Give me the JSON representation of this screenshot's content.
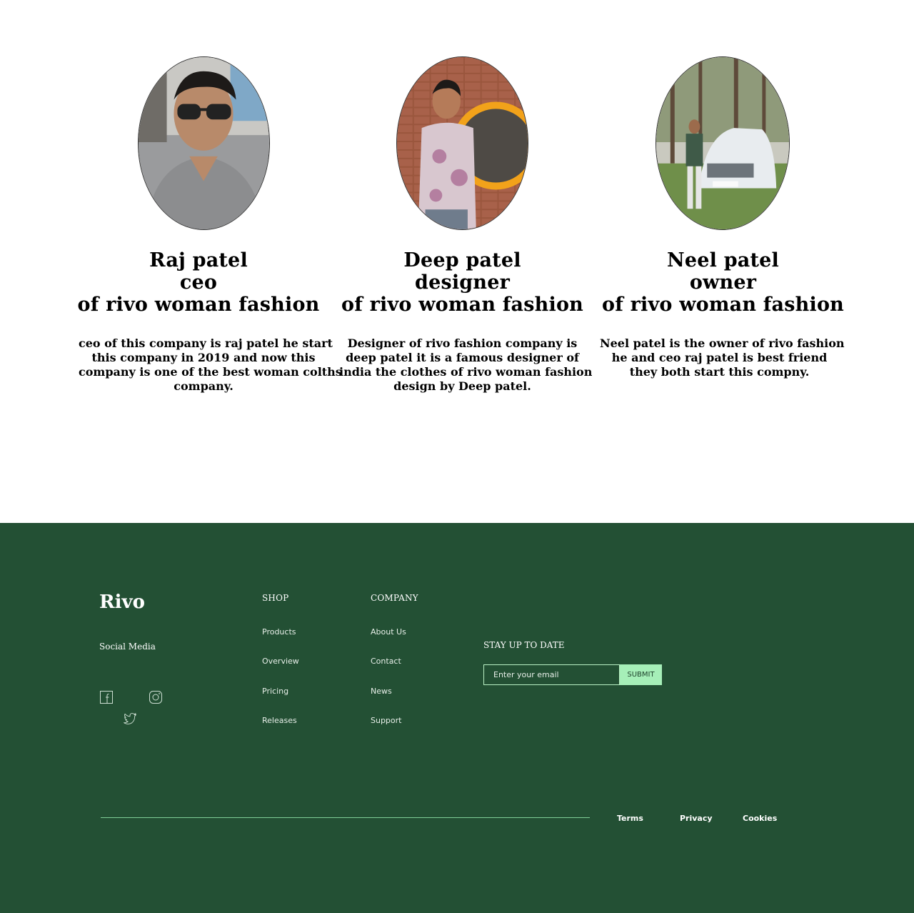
{
  "team": [
    {
      "name": "Raj patel",
      "role": "ceo",
      "company": "of rivo woman fashion",
      "bio": [
        "ceo of this company is raj patel  he start",
        "this company in 2019 and now this",
        "company is one of the best woman colths",
        "company."
      ]
    },
    {
      "name": "Deep patel",
      "role": "designer",
      "company": "of rivo woman fashion",
      "bio": [
        "Designer of rivo fashion company  is",
        "deep patel it is a famous designer of",
        "india the clothes of rivo woman fashion",
        "design by Deep patel."
      ]
    },
    {
      "name": "Neel patel",
      "role": "owner",
      "company": "of rivo woman fashion",
      "bio": [
        "Neel patel is the owner of rivo fashion",
        "he and ceo raj patel is best friend",
        "they  both start this compny."
      ]
    }
  ],
  "footer": {
    "brand": "Rivo",
    "social_title": "Social Media",
    "social_icons": [
      "facebook-icon",
      "instagram-icon",
      "twitter-icon"
    ],
    "shop": {
      "title": "SHOP",
      "links": [
        "Products",
        "Overview",
        "Pricing",
        "Releases"
      ]
    },
    "company": {
      "title": "COMPANY",
      "links": [
        "About Us",
        "Contact",
        "News",
        "Support"
      ]
    },
    "newsletter": {
      "title": "STAY UP TO DATE",
      "placeholder": "Enter your email",
      "submit_label": "SUBMIT"
    },
    "legal": [
      "Terms",
      "Privacy",
      "Cookies"
    ]
  },
  "colors": {
    "footer_bg": "#235034",
    "accent": "#a6efb8",
    "divider": "#7fcf98"
  }
}
